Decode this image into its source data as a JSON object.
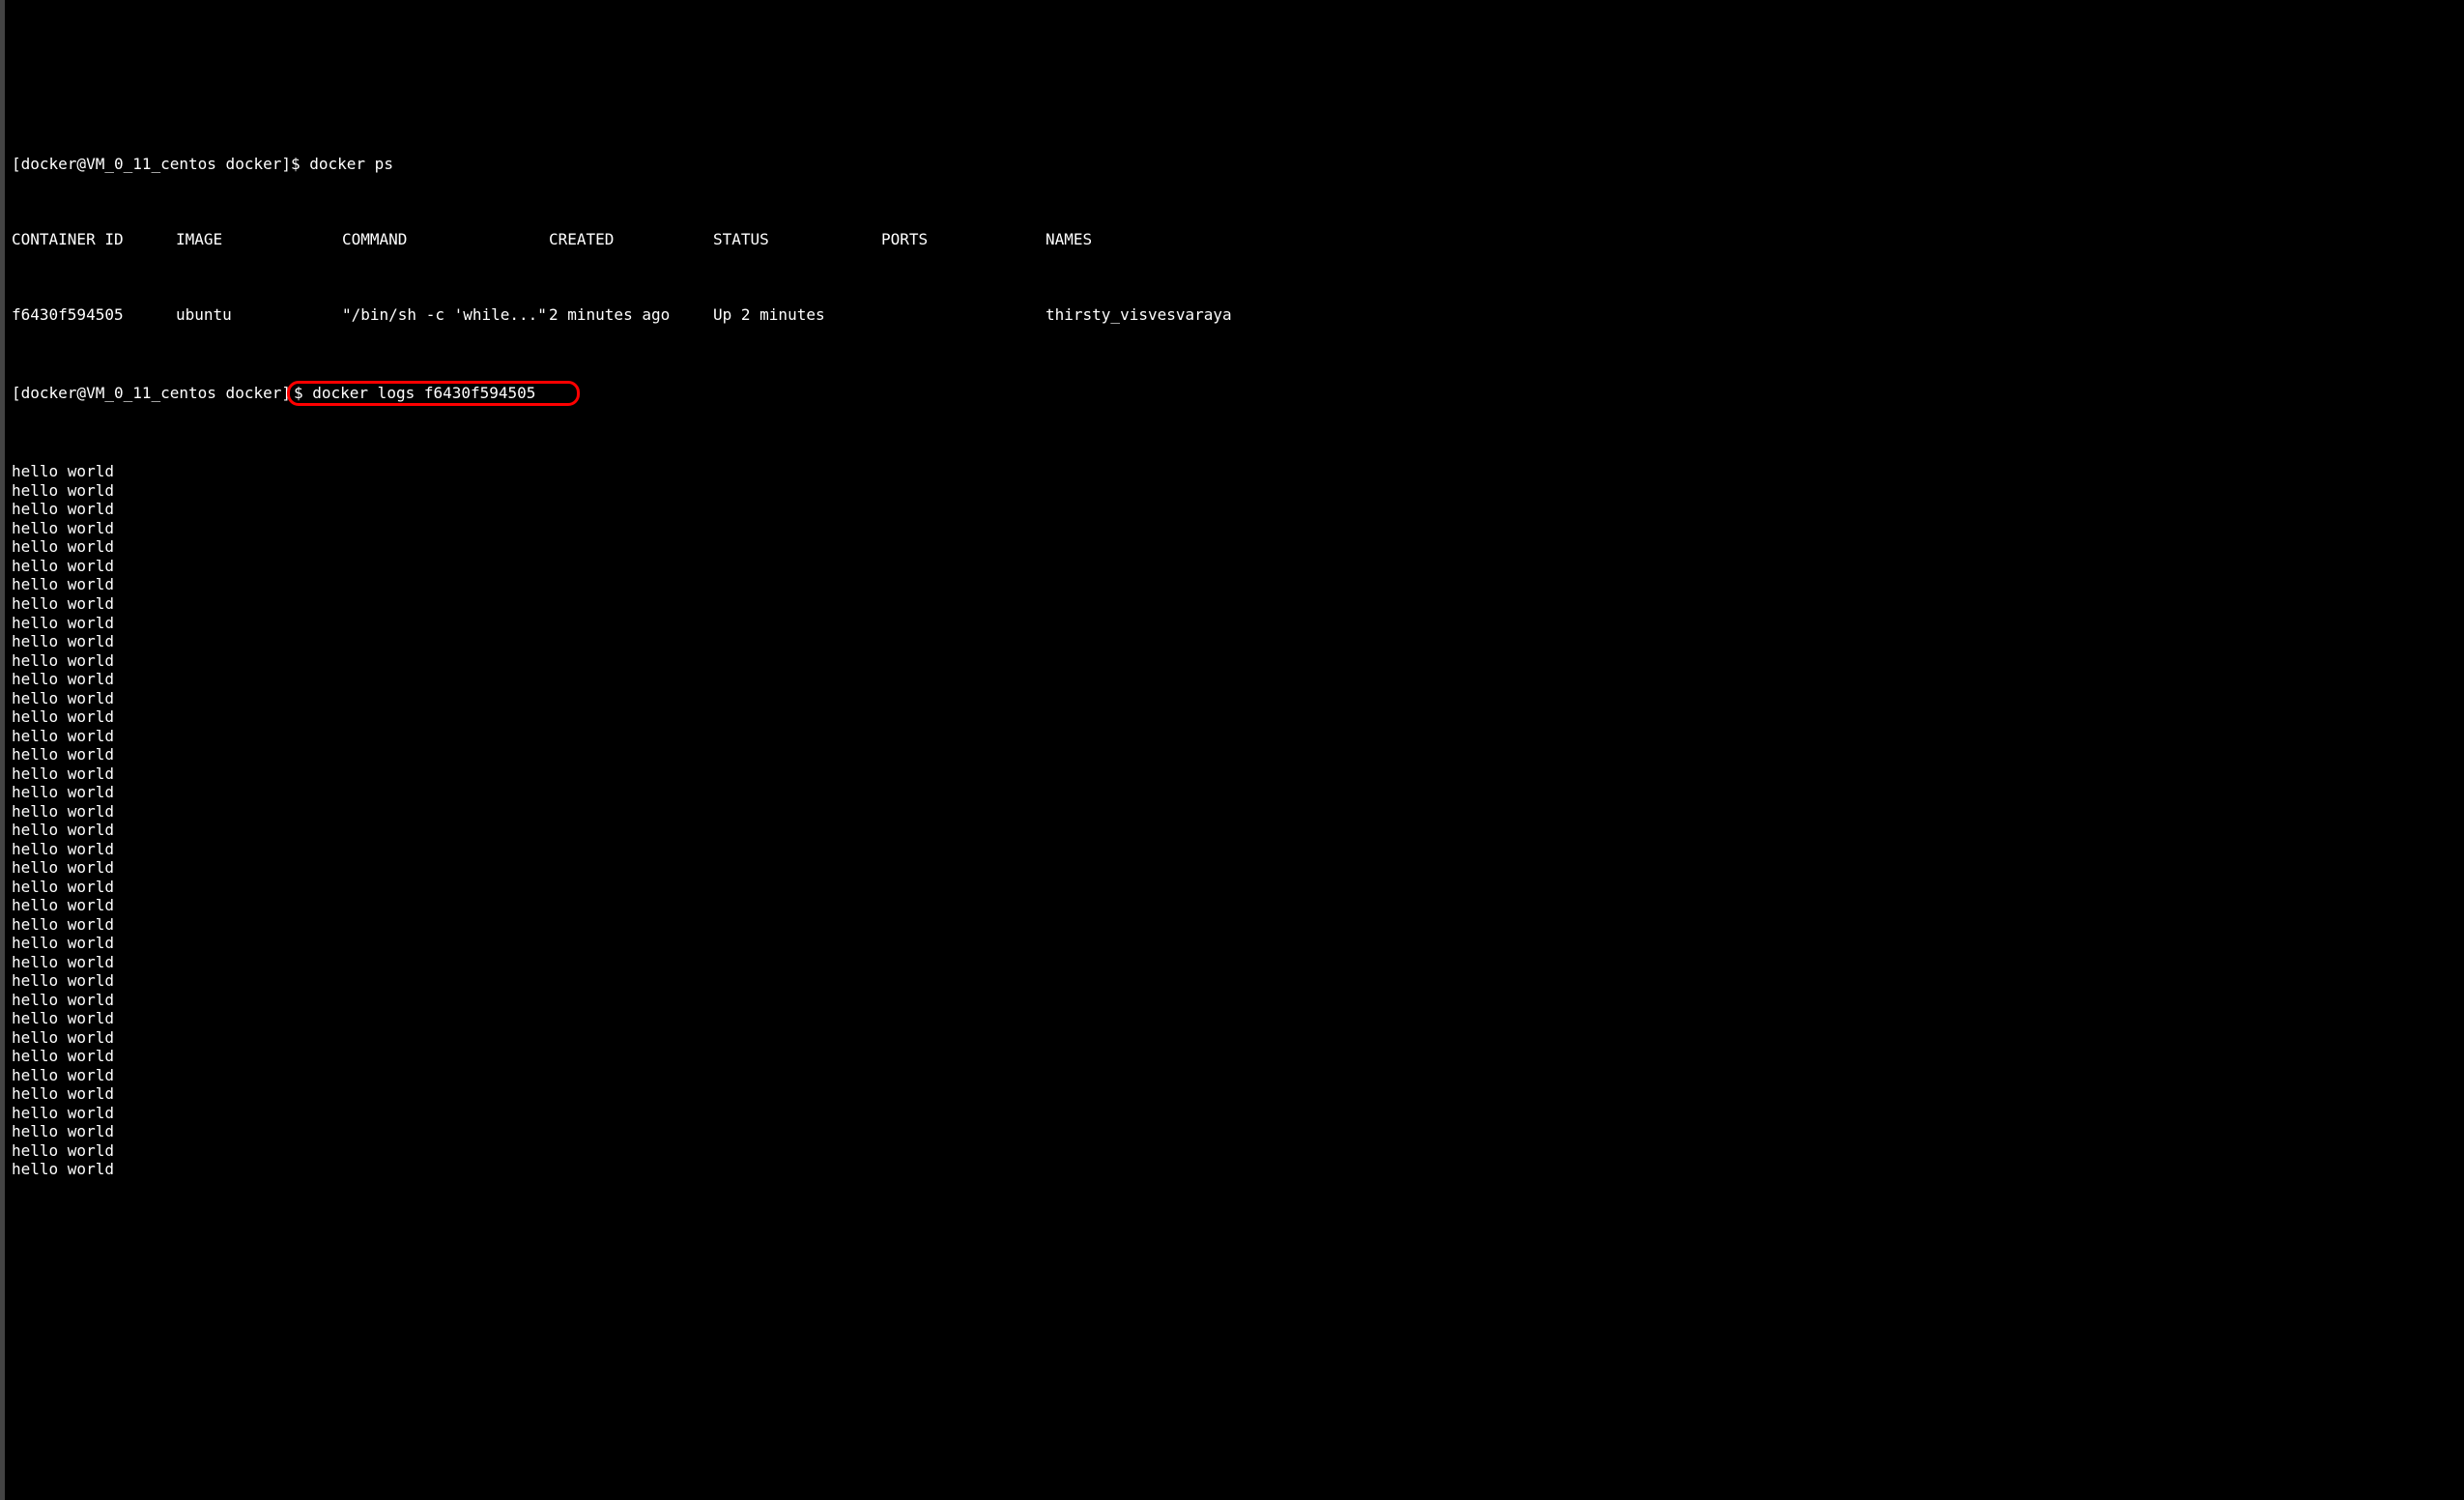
{
  "prompt1": {
    "prefix": "[docker@VM_0_11_centos docker]$ ",
    "command": "docker ps"
  },
  "table": {
    "headers": {
      "container_id": "CONTAINER ID",
      "image": "IMAGE",
      "command": "COMMAND",
      "created": "CREATED",
      "status": "STATUS",
      "ports": "PORTS",
      "names": "NAMES"
    },
    "row": {
      "container_id": "f6430f594505",
      "image": "ubuntu",
      "command": "\"/bin/sh -c 'while...\"",
      "created": "2 minutes ago",
      "status": "Up 2 minutes",
      "ports": "",
      "names": "thirsty_visvesvaraya"
    }
  },
  "prompt2": {
    "prefix": "[docker@VM_0_11_centos docker]",
    "highlighted": "$ docker logs f6430f594505"
  },
  "log_line": "hello world",
  "log_count": 38
}
